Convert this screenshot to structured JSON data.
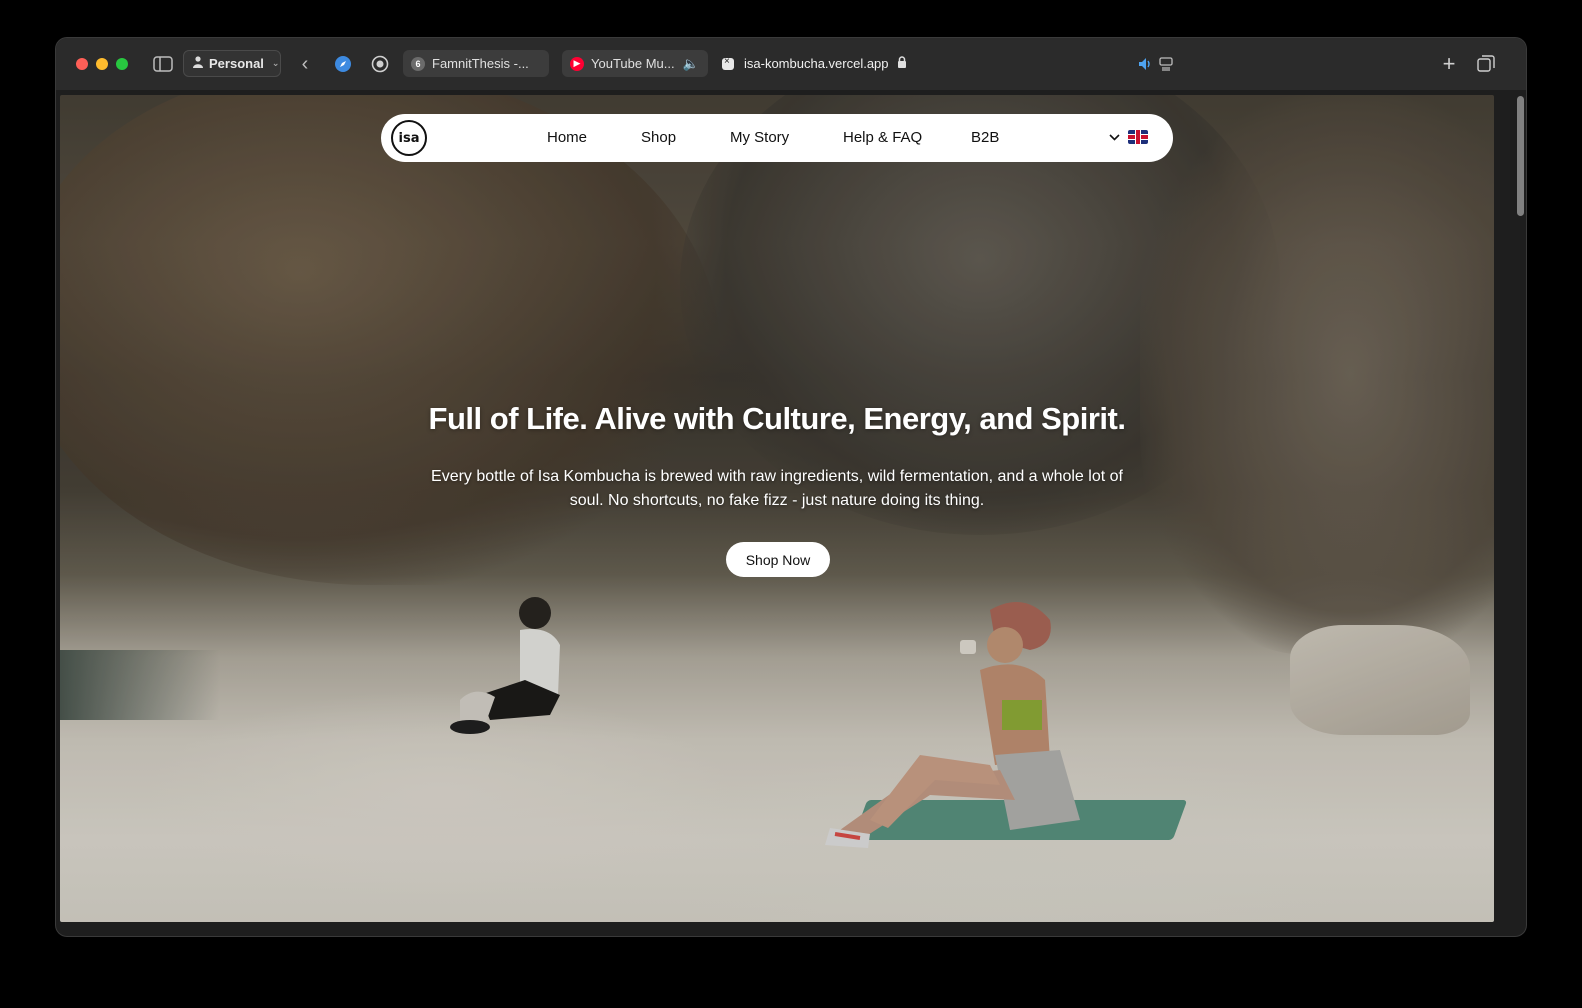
{
  "browser": {
    "profile_label": "Personal",
    "tabs": [
      {
        "title": "FamnitThesis -...",
        "favicon_color": "#6b6b6b",
        "favicon_glyph": "6"
      },
      {
        "title": "YouTube Mu...",
        "favicon_color": "#ff0033",
        "favicon_glyph": "▶"
      }
    ],
    "active_url": "isa-kombucha.vercel.app",
    "icons": [
      "sidebar-icon",
      "back-icon",
      "safari-compass-icon",
      "privacy-shield-icon",
      "lock-icon",
      "speaker-icon",
      "picture-in-picture-icon",
      "new-tab-icon",
      "tab-overview-icon"
    ]
  },
  "site": {
    "logo_text": "isa",
    "nav": [
      "Home",
      "Shop",
      "My Story",
      "Help & FAQ",
      "B2B"
    ],
    "hero": {
      "title": "Full of Life. Alive with Culture, Energy, and Spirit.",
      "subtitle": "Every bottle of Isa Kombucha is brewed with raw ingredients, wild fermentation, and a whole lot of soul. No shortcuts, no fake fizz - just nature doing its thing.",
      "cta": "Shop Now"
    }
  }
}
